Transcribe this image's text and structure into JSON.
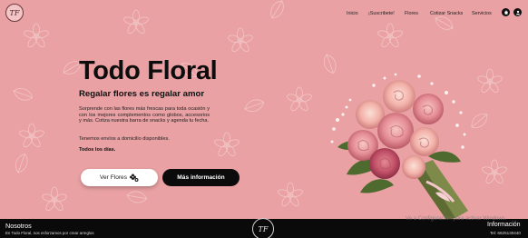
{
  "header": {
    "logo_text": "TF",
    "nav": [
      {
        "label": "Inicio"
      },
      {
        "label": "¡Suscribete!"
      },
      {
        "label": "Flores"
      },
      {
        "label": "Cotizar Snacks"
      },
      {
        "label": "Servicios"
      }
    ],
    "icons": [
      "cart-icon",
      "user-icon"
    ]
  },
  "hero": {
    "title": "Todo Floral",
    "subtitle": "Regalar flores es regalar amor",
    "description": "Sorprende con las flores más frescas para toda ocasión y con los mejores complementos como globos, accesorios y más. Cotiza nuestra barra de snacks y agenda tu fecha.",
    "shipping": "Tenemos envíos a domicilio disponibles.",
    "days": "Todos los días.",
    "btn_flowers": "Ver Flores",
    "btn_info": "Más información"
  },
  "footer": {
    "title": "Nosotros",
    "text": "En Todo Floral, nos esforzamos por crear arreglos",
    "logo_text": "TF",
    "info_title": "Información",
    "phone": "Tel: 6625130440"
  },
  "watermark": "Ve a Configuración para activar Windows.",
  "colors": {
    "background": "#e9a1a3",
    "pattern": "#f1c0c1",
    "primary": "#0b0b0b",
    "footer": "#0a0a0a"
  }
}
